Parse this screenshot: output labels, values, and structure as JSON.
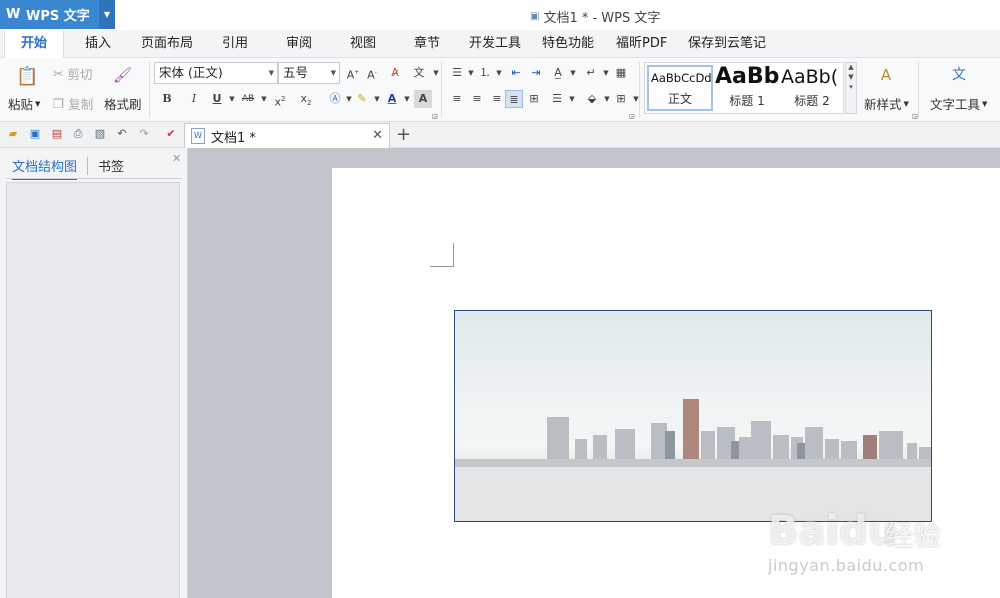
{
  "app": {
    "logo": "W",
    "name": "WPS 文字",
    "title": "文档1 * - WPS 文字",
    "accent": "#3a86d0"
  },
  "menu": [
    "开始",
    "插入",
    "页面布局",
    "引用",
    "审阅",
    "视图",
    "章节",
    "开发工具",
    "特色功能",
    "福昕PDF",
    "保存到云笔记"
  ],
  "ribbon": {
    "paste": "粘贴",
    "cut": "剪切",
    "copy": "复制",
    "format_painter": "格式刷",
    "font_name": "宋体 (正文)",
    "font_size": "五号",
    "styles": [
      {
        "sample": "AaBbCcDd",
        "label": "正文"
      },
      {
        "sample": "AaBb",
        "label": "标题 1"
      },
      {
        "sample": "AaBb(",
        "label": "标题 2"
      }
    ],
    "new_style": "新样式",
    "text_tools": "文字工具"
  },
  "document_tab": {
    "title": "文档1 *"
  },
  "left_pane": {
    "tab_outline": "文档结构图",
    "tab_bookmarks": "书签"
  },
  "watermark": {
    "brand": "Baidu",
    "cn": "经验",
    "url": "jingyan.baidu.com"
  }
}
